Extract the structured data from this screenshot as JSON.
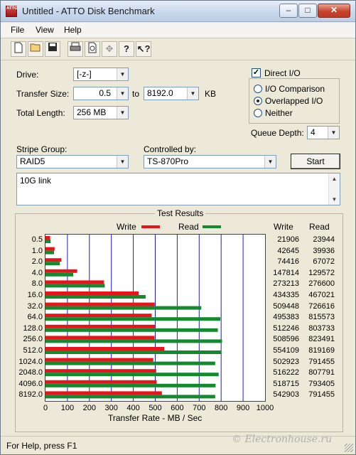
{
  "window": {
    "title": "Untitled - ATTO Disk Benchmark",
    "minimize": "–",
    "maximize": "□",
    "close": "✕",
    "app_icon_text": "ATTO"
  },
  "menu": [
    "File",
    "View",
    "Help"
  ],
  "toolbar": [
    "new-icon",
    "open-icon",
    "save-icon",
    "print-icon",
    "print-preview-icon",
    "move-icon",
    "help-icon",
    "context-help-icon"
  ],
  "settings": {
    "drive_label": "Drive:",
    "drive_value": "[-z-]",
    "transfer_size_label": "Transfer Size:",
    "transfer_from": "0.5",
    "to_label": "to",
    "transfer_to": "8192.0",
    "kb_label": "KB",
    "total_length_label": "Total Length:",
    "total_length_value": "256 MB",
    "direct_io_label": "Direct I/O",
    "direct_io_checked": true,
    "io_comparison_label": "I/O Comparison",
    "overlapped_io_label": "Overlapped I/O",
    "neither_label": "Neither",
    "selected_mode": "Overlapped I/O",
    "queue_depth_label": "Queue Depth:",
    "queue_depth_value": "4",
    "stripe_group_label": "Stripe Group:",
    "stripe_group_value": "RAID5",
    "controlled_by_label": "Controlled by:",
    "controlled_by_value": "TS-870Pro",
    "start_button": "Start",
    "notes": "10G link"
  },
  "results": {
    "frame_title": "Test Results",
    "write_legend": "Write",
    "read_legend": "Read",
    "write_col": "Write",
    "read_col": "Read",
    "x_axis_label": "Transfer Rate - MB / Sec"
  },
  "chart_data": {
    "type": "bar",
    "orientation": "horizontal",
    "categories": [
      "0.5",
      "1.0",
      "2.0",
      "4.0",
      "8.0",
      "16.0",
      "32.0",
      "64.0",
      "128.0",
      "256.0",
      "512.0",
      "1024.0",
      "2048.0",
      "4096.0",
      "8192.0"
    ],
    "series": [
      {
        "name": "Write",
        "color": "#e8141b",
        "values": [
          21906,
          42645,
          74416,
          147814,
          273213,
          434335,
          509448,
          495383,
          512246,
          508596,
          554109,
          502923,
          516222,
          518715,
          542903
        ]
      },
      {
        "name": "Read",
        "color": "#138a2e",
        "values": [
          23944,
          39936,
          67072,
          129572,
          276600,
          467021,
          726616,
          815573,
          803733,
          823491,
          819169,
          791455,
          807791,
          793405,
          791455
        ]
      }
    ],
    "xlabel": "Transfer Rate - MB / Sec",
    "xticks": [
      "0",
      "100",
      "200",
      "300",
      "400",
      "500",
      "600",
      "700",
      "800",
      "900",
      "1000"
    ],
    "xlim": [
      0,
      1000
    ],
    "grid": true,
    "legend": "top-center"
  },
  "status": {
    "text": "For Help, press F1",
    "watermark": "© Electronhouse.ru"
  }
}
